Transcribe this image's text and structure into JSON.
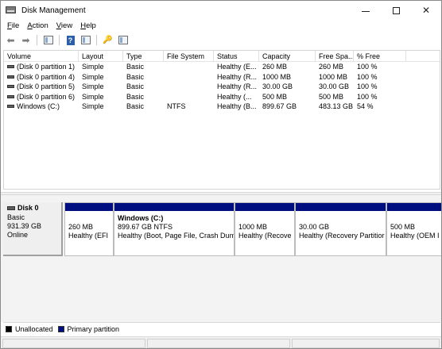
{
  "window": {
    "title": "Disk Management"
  },
  "menu": [
    {
      "label": "File",
      "key": "F",
      "rest": "ile"
    },
    {
      "label": "Action",
      "key": "A",
      "rest": "ction"
    },
    {
      "label": "View",
      "key": "V",
      "rest": "iew"
    },
    {
      "label": "Help",
      "key": "H",
      "rest": "elp"
    }
  ],
  "toolbar": {
    "icons": [
      "back-arrow-icon",
      "forward-arrow-icon",
      "console-tree-icon",
      "help-icon",
      "properties-icon",
      "rescan-disks-icon",
      "disk-list-icon"
    ]
  },
  "columns": [
    "Volume",
    "Layout",
    "Type",
    "File System",
    "Status",
    "Capacity",
    "Free Spa...",
    "% Free"
  ],
  "volumes": [
    {
      "volume": "(Disk 0 partition 1)",
      "layout": "Simple",
      "type": "Basic",
      "fs": "",
      "status": "Healthy (E...",
      "capacity": "260 MB",
      "free": "260 MB",
      "pct": "100 %"
    },
    {
      "volume": "(Disk 0 partition 4)",
      "layout": "Simple",
      "type": "Basic",
      "fs": "",
      "status": "Healthy (R...",
      "capacity": "1000 MB",
      "free": "1000 MB",
      "pct": "100 %"
    },
    {
      "volume": "(Disk 0 partition 5)",
      "layout": "Simple",
      "type": "Basic",
      "fs": "",
      "status": "Healthy (R...",
      "capacity": "30.00 GB",
      "free": "30.00 GB",
      "pct": "100 %"
    },
    {
      "volume": "(Disk 0 partition 6)",
      "layout": "Simple",
      "type": "Basic",
      "fs": "",
      "status": "Healthy (...",
      "capacity": "500 MB",
      "free": "500 MB",
      "pct": "100 %"
    },
    {
      "volume": "Windows (C:)",
      "layout": "Simple",
      "type": "Basic",
      "fs": "NTFS",
      "status": "Healthy (B...",
      "capacity": "899.67 GB",
      "free": "483.13 GB",
      "pct": "54 %"
    }
  ],
  "disk": {
    "name": "Disk 0",
    "type": "Basic",
    "size": "931.39 GB",
    "state": "Online",
    "partitions": [
      {
        "name": "",
        "size": "260 MB",
        "status": "Healthy (EFI"
      },
      {
        "name": "Windows  (C:)",
        "size": "899.67 GB NTFS",
        "status": "Healthy (Boot, Page File, Crash Dum"
      },
      {
        "name": "",
        "size": "1000 MB",
        "status": "Healthy (Recove"
      },
      {
        "name": "",
        "size": "30.00 GB",
        "status": "Healthy (Recovery Partitior"
      },
      {
        "name": "",
        "size": "500 MB",
        "status": "Healthy (OEM I"
      }
    ]
  },
  "legend": [
    {
      "label": "Unallocated",
      "color": "#000000"
    },
    {
      "label": "Primary partition",
      "color": "#000f80"
    }
  ],
  "colors": {
    "primary_partition": "#000f80",
    "unallocated": "#000000"
  }
}
